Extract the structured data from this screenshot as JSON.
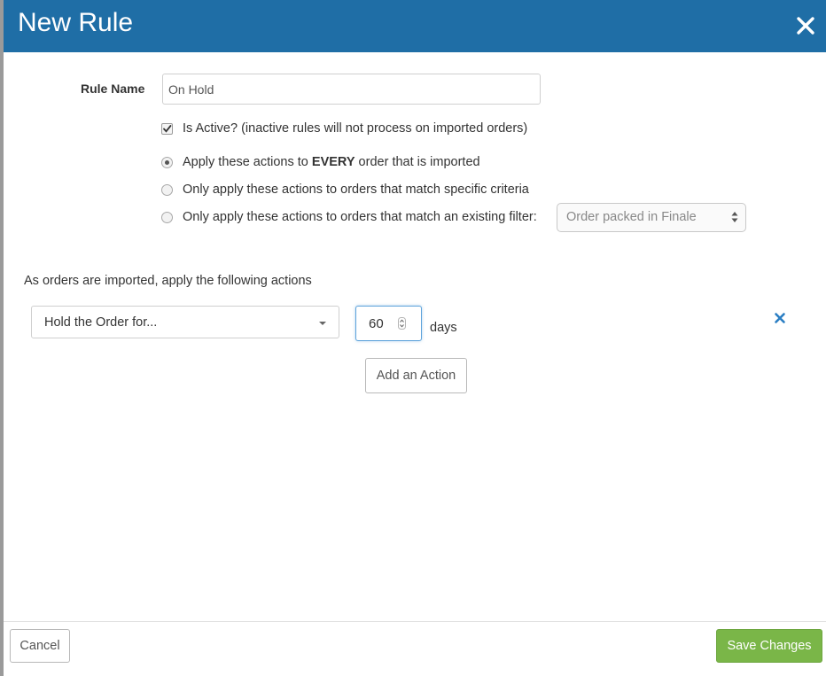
{
  "dialog": {
    "title": "New Rule",
    "close_icon": "close-icon"
  },
  "form": {
    "rule_name_label": "Rule Name",
    "rule_name_value": "On Hold",
    "is_active": {
      "checked": true,
      "label": "Is Active? (inactive rules will not process on imported orders)"
    },
    "scope_options": [
      {
        "checked": true,
        "label_prefix": "Apply these actions to ",
        "label_bold": "EVERY",
        "label_suffix": " order that is imported"
      },
      {
        "checked": false,
        "label": "Only apply these actions to orders that match specific criteria"
      },
      {
        "checked": false,
        "label": "Only apply these actions to orders that match an existing filter:"
      }
    ],
    "filter_select_value": "Order packed in Finale"
  },
  "actions_section": {
    "heading": "As orders are imported, apply the following actions",
    "actions": [
      {
        "type_value": "Hold the Order for...",
        "amount": "60",
        "unit": "days",
        "remove_icon": "remove-icon"
      }
    ],
    "add_button_label": "Add an Action"
  },
  "footer": {
    "cancel_label": "Cancel",
    "save_label": "Save Changes"
  },
  "colors": {
    "header_bg": "#1f6ea6",
    "save_bg": "#7ab648",
    "remove_icon": "#2a7ec3",
    "focus_border": "#5ea3db"
  }
}
